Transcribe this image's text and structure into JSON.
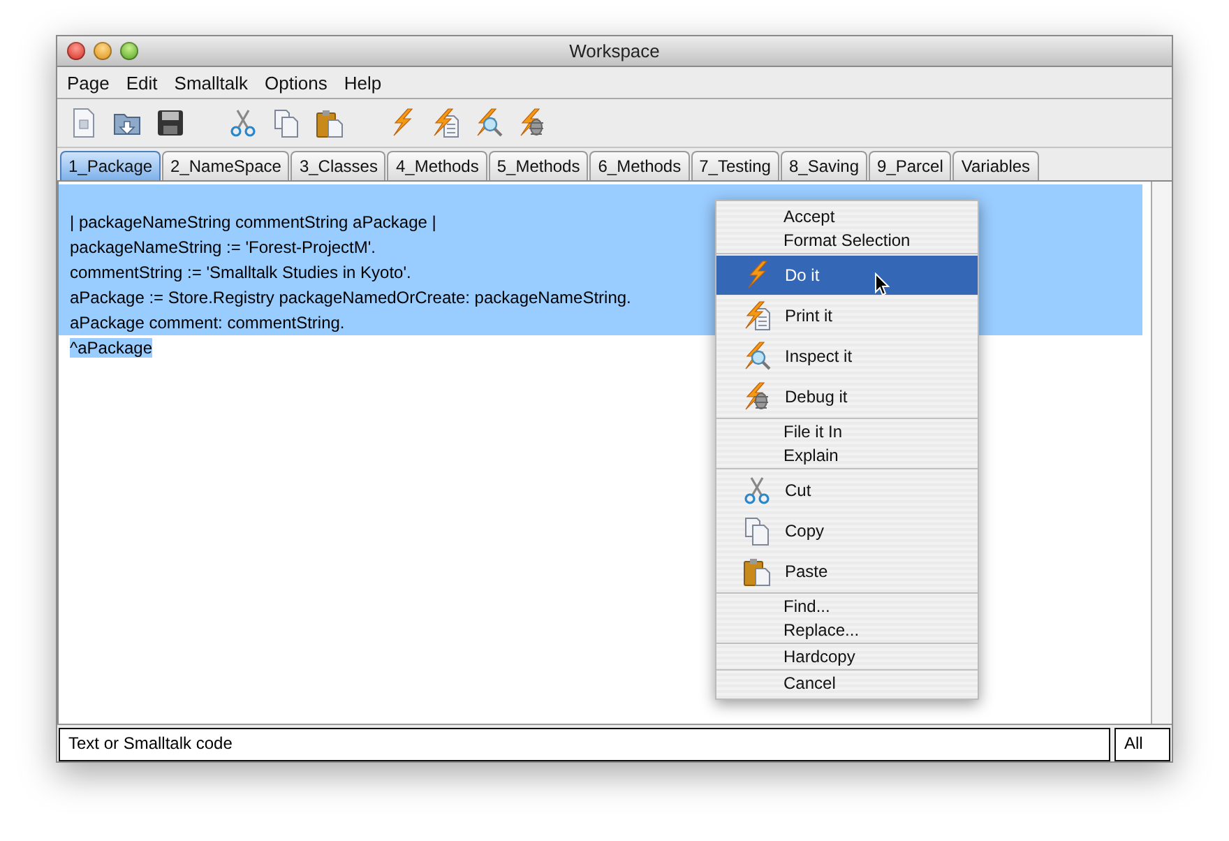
{
  "window": {
    "title": "Workspace"
  },
  "menu_bar": [
    "Page",
    "Edit",
    "Smalltalk",
    "Options",
    "Help"
  ],
  "tabs": [
    {
      "label": "1_Package",
      "selected": true
    },
    {
      "label": "2_NameSpace",
      "selected": false
    },
    {
      "label": "3_Classes",
      "selected": false
    },
    {
      "label": "4_Methods",
      "selected": false
    },
    {
      "label": "5_Methods",
      "selected": false
    },
    {
      "label": "6_Methods",
      "selected": false
    },
    {
      "label": "7_Testing",
      "selected": false
    },
    {
      "label": "8_Saving",
      "selected": false
    },
    {
      "label": "9_Parcel",
      "selected": false
    },
    {
      "label": "Variables",
      "selected": false
    }
  ],
  "editor": {
    "lines": [
      {
        "text": "| packageNameString commentString aPackage |",
        "selected": true
      },
      {
        "text": "packageNameString := 'Forest-ProjectM'.",
        "selected": true
      },
      {
        "text": "commentString := 'Smalltalk Studies in Kyoto'.",
        "selected": true
      },
      {
        "text": "aPackage := Store.Registry packageNamedOrCreate: packageNameString.",
        "selected": true
      },
      {
        "text": "aPackage comment: commentString.",
        "selected": true
      },
      {
        "text": "^aPackage",
        "selected": true
      }
    ]
  },
  "context_menu": {
    "groups": [
      [
        {
          "label": "Accept",
          "kind": "plain",
          "selected": false
        },
        {
          "label": "Format Selection",
          "kind": "plain",
          "selected": false
        }
      ],
      [
        {
          "label": "Do it",
          "kind": "doit",
          "selected": true
        },
        {
          "label": "Print it",
          "kind": "printit",
          "selected": false
        },
        {
          "label": "Inspect it",
          "kind": "inspect",
          "selected": false
        },
        {
          "label": "Debug it",
          "kind": "debug",
          "selected": false
        }
      ],
      [
        {
          "label": "File it In",
          "kind": "plain",
          "selected": false
        },
        {
          "label": "Explain",
          "kind": "plain",
          "selected": false
        }
      ],
      [
        {
          "label": "Cut",
          "kind": "cut",
          "selected": false
        },
        {
          "label": "Copy",
          "kind": "copy",
          "selected": false
        },
        {
          "label": "Paste",
          "kind": "paste",
          "selected": false
        }
      ],
      [
        {
          "label": "Find...",
          "kind": "plain",
          "selected": false
        },
        {
          "label": "Replace...",
          "kind": "plain",
          "selected": false
        }
      ],
      [
        {
          "label": "Hardcopy",
          "kind": "plain",
          "selected": false
        }
      ],
      [
        {
          "label": "Cancel",
          "kind": "plain",
          "selected": false
        }
      ]
    ]
  },
  "status_bar": {
    "text": "Text or Smalltalk code",
    "scope": "All"
  }
}
